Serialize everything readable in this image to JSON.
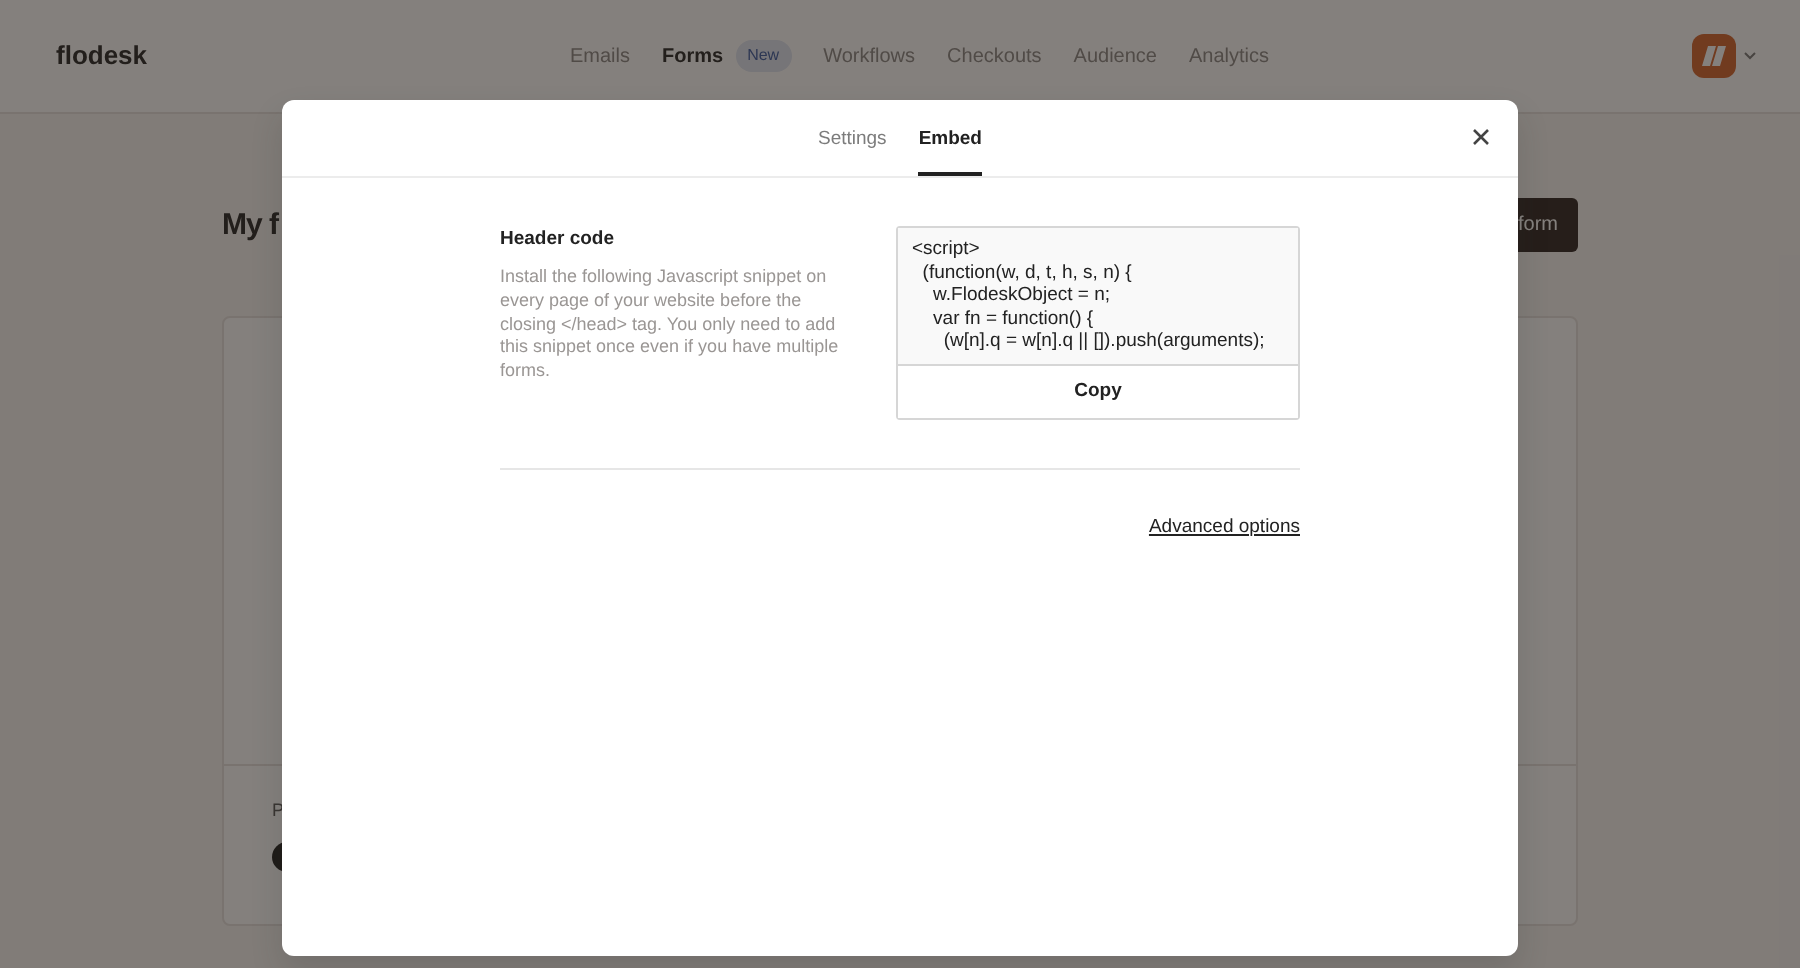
{
  "header": {
    "logo": "flodesk",
    "nav": [
      {
        "label": "Emails",
        "selected": false
      },
      {
        "label": "Forms",
        "selected": true,
        "badge": "New"
      },
      {
        "label": "Workflows",
        "selected": false
      },
      {
        "label": "Checkouts",
        "selected": false
      },
      {
        "label": "Audience",
        "selected": false
      },
      {
        "label": "Analytics",
        "selected": false
      }
    ]
  },
  "page": {
    "title": "My f",
    "button": "form",
    "card_label": "P"
  },
  "modal": {
    "tabs": [
      {
        "label": "Settings",
        "selected": false
      },
      {
        "label": "Embed",
        "selected": true
      }
    ],
    "section": {
      "title": "Header code",
      "description": "Install the following Javascript snippet on every page of your website before the closing </head> tag. You only need to add this snippet once even if you have multiple forms.",
      "code": "<script>\n  (function(w, d, t, h, s, n) {\n    w.FlodeskObject = n;\n    var fn = function() {\n      (w[n].q = w[n].q || []).push(arguments);",
      "copy_button": "Copy"
    },
    "link": "Advanced options"
  }
}
